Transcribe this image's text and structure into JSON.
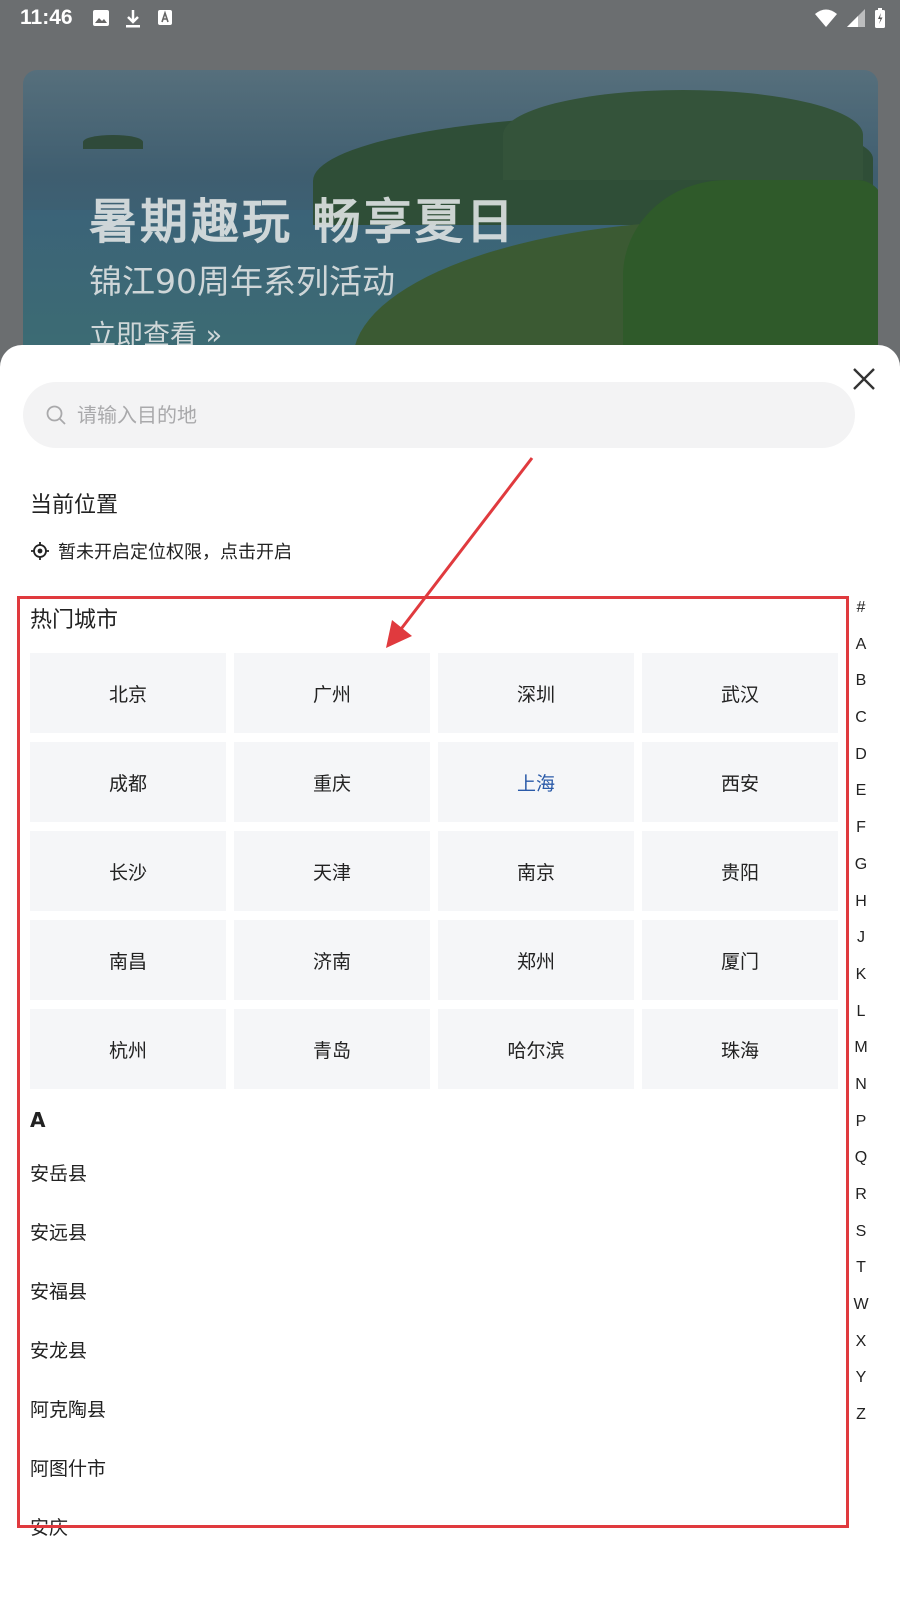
{
  "status_bar": {
    "time": "11:46",
    "left_icons": [
      "image-icon",
      "download-icon",
      "text-notification-icon"
    ],
    "right_icons": [
      "wifi-icon",
      "signal-icon",
      "battery-icon"
    ]
  },
  "banner": {
    "title": "暑期趣玩 畅享夏日",
    "subtitle": "锦江90周年系列活动",
    "link": "立即查看 »"
  },
  "search": {
    "placeholder": "请输入目的地",
    "value": ""
  },
  "current_location": {
    "title": "当前位置",
    "message": "暂未开启定位权限，点击开启"
  },
  "hot_cities": {
    "title": "热门城市",
    "cities": [
      "北京",
      "广州",
      "深圳",
      "武汉",
      "成都",
      "重庆",
      "上海",
      "西安",
      "长沙",
      "天津",
      "南京",
      "贵阳",
      "南昌",
      "济南",
      "郑州",
      "厦门",
      "杭州",
      "青岛",
      "哈尔滨",
      "珠海"
    ],
    "selected": "上海"
  },
  "city_list": {
    "letter": "A",
    "items": [
      "安岳县",
      "安远县",
      "安福县",
      "安龙县",
      "阿克陶县",
      "阿图什市",
      "安庆"
    ]
  },
  "index_letters": [
    "#",
    "A",
    "B",
    "C",
    "D",
    "E",
    "F",
    "G",
    "H",
    "J",
    "K",
    "L",
    "M",
    "N",
    "P",
    "Q",
    "R",
    "S",
    "T",
    "W",
    "X",
    "Y",
    "Z"
  ],
  "colors": {
    "accent_selected": "#2a5aa8",
    "annotation": "#e03a3e",
    "tile_bg": "#f5f6f8"
  }
}
